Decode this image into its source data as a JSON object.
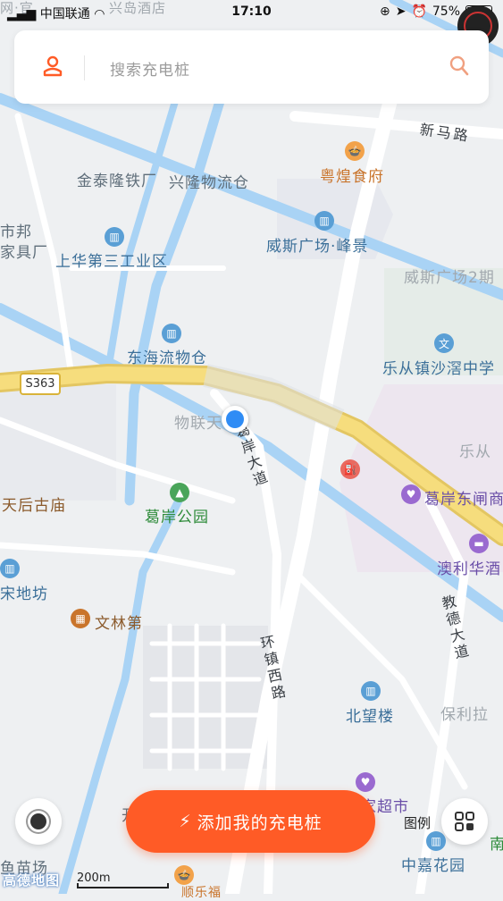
{
  "status_bar": {
    "carrier": "中国联通",
    "time": "17:10",
    "battery": "75%",
    "battery_level": 0.75
  },
  "search": {
    "placeholder": "搜索充电桩",
    "user_icon": "user-icon",
    "search_icon": "search-icon"
  },
  "map": {
    "top_cut_labels": {
      "left": "网·官",
      "right": "兴岛酒店"
    },
    "highway_shield": "S363",
    "roads": {
      "xinma": "新马路",
      "gean_avenue": "葛岸大道",
      "huanzhen_west": "环镇西路",
      "jiaode": "教德大道"
    },
    "labels": {
      "jintai": "金泰隆铁厂",
      "xinglong": "兴隆物流仓",
      "yuehuang": "粤煌食府",
      "shibang": "市邦",
      "jiaju": "家具厂",
      "weisi_square": "威斯广场·峰景",
      "weisi_square2": "威斯广场2期",
      "shanghua": "上华第三工业区",
      "donghai": "东海流物仓",
      "lecong_school": "乐从镇沙滘中学",
      "wulian": "物联天",
      "lecong": "乐从",
      "tianhou": "天后古庙",
      "gean_park": "葛岸公园",
      "gean_dongzha": "葛岸东闸商",
      "aoli": "澳利华酒",
      "song": "宋地坊",
      "wenlin": "文林第",
      "beiwang": "北望楼",
      "baoli": "保利拉",
      "chaoshi": "家超市",
      "kai": "开",
      "yumiao": "鱼苗场",
      "zhongjia": "中嘉花园",
      "shunle": "顺乐福",
      "nan": "南"
    }
  },
  "bottom": {
    "add_button": "添加我的充电桩",
    "legend": "图例",
    "scale": "200m",
    "logo": "高德地图"
  },
  "colors": {
    "accent": "#ff5b26",
    "water": "#a9d3f5",
    "highway": "#f4d774",
    "location": "#2f8cf5"
  }
}
